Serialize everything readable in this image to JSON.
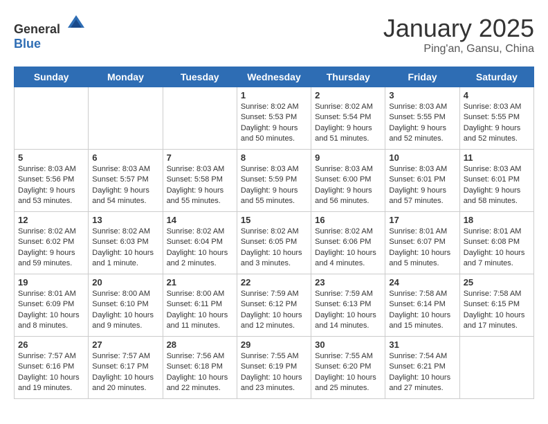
{
  "header": {
    "logo_general": "General",
    "logo_blue": "Blue",
    "title": "January 2025",
    "subtitle": "Ping'an, Gansu, China"
  },
  "days": [
    "Sunday",
    "Monday",
    "Tuesday",
    "Wednesday",
    "Thursday",
    "Friday",
    "Saturday"
  ],
  "weeks": [
    [
      {
        "date": "",
        "text": ""
      },
      {
        "date": "",
        "text": ""
      },
      {
        "date": "",
        "text": ""
      },
      {
        "date": "1",
        "text": "Sunrise: 8:02 AM\nSunset: 5:53 PM\nDaylight: 9 hours and 50 minutes."
      },
      {
        "date": "2",
        "text": "Sunrise: 8:02 AM\nSunset: 5:54 PM\nDaylight: 9 hours and 51 minutes."
      },
      {
        "date": "3",
        "text": "Sunrise: 8:03 AM\nSunset: 5:55 PM\nDaylight: 9 hours and 52 minutes."
      },
      {
        "date": "4",
        "text": "Sunrise: 8:03 AM\nSunset: 5:55 PM\nDaylight: 9 hours and 52 minutes."
      }
    ],
    [
      {
        "date": "5",
        "text": "Sunrise: 8:03 AM\nSunset: 5:56 PM\nDaylight: 9 hours and 53 minutes."
      },
      {
        "date": "6",
        "text": "Sunrise: 8:03 AM\nSunset: 5:57 PM\nDaylight: 9 hours and 54 minutes."
      },
      {
        "date": "7",
        "text": "Sunrise: 8:03 AM\nSunset: 5:58 PM\nDaylight: 9 hours and 55 minutes."
      },
      {
        "date": "8",
        "text": "Sunrise: 8:03 AM\nSunset: 5:59 PM\nDaylight: 9 hours and 55 minutes."
      },
      {
        "date": "9",
        "text": "Sunrise: 8:03 AM\nSunset: 6:00 PM\nDaylight: 9 hours and 56 minutes."
      },
      {
        "date": "10",
        "text": "Sunrise: 8:03 AM\nSunset: 6:01 PM\nDaylight: 9 hours and 57 minutes."
      },
      {
        "date": "11",
        "text": "Sunrise: 8:03 AM\nSunset: 6:01 PM\nDaylight: 9 hours and 58 minutes."
      }
    ],
    [
      {
        "date": "12",
        "text": "Sunrise: 8:02 AM\nSunset: 6:02 PM\nDaylight: 9 hours and 59 minutes."
      },
      {
        "date": "13",
        "text": "Sunrise: 8:02 AM\nSunset: 6:03 PM\nDaylight: 10 hours and 1 minute."
      },
      {
        "date": "14",
        "text": "Sunrise: 8:02 AM\nSunset: 6:04 PM\nDaylight: 10 hours and 2 minutes."
      },
      {
        "date": "15",
        "text": "Sunrise: 8:02 AM\nSunset: 6:05 PM\nDaylight: 10 hours and 3 minutes."
      },
      {
        "date": "16",
        "text": "Sunrise: 8:02 AM\nSunset: 6:06 PM\nDaylight: 10 hours and 4 minutes."
      },
      {
        "date": "17",
        "text": "Sunrise: 8:01 AM\nSunset: 6:07 PM\nDaylight: 10 hours and 5 minutes."
      },
      {
        "date": "18",
        "text": "Sunrise: 8:01 AM\nSunset: 6:08 PM\nDaylight: 10 hours and 7 minutes."
      }
    ],
    [
      {
        "date": "19",
        "text": "Sunrise: 8:01 AM\nSunset: 6:09 PM\nDaylight: 10 hours and 8 minutes."
      },
      {
        "date": "20",
        "text": "Sunrise: 8:00 AM\nSunset: 6:10 PM\nDaylight: 10 hours and 9 minutes."
      },
      {
        "date": "21",
        "text": "Sunrise: 8:00 AM\nSunset: 6:11 PM\nDaylight: 10 hours and 11 minutes."
      },
      {
        "date": "22",
        "text": "Sunrise: 7:59 AM\nSunset: 6:12 PM\nDaylight: 10 hours and 12 minutes."
      },
      {
        "date": "23",
        "text": "Sunrise: 7:59 AM\nSunset: 6:13 PM\nDaylight: 10 hours and 14 minutes."
      },
      {
        "date": "24",
        "text": "Sunrise: 7:58 AM\nSunset: 6:14 PM\nDaylight: 10 hours and 15 minutes."
      },
      {
        "date": "25",
        "text": "Sunrise: 7:58 AM\nSunset: 6:15 PM\nDaylight: 10 hours and 17 minutes."
      }
    ],
    [
      {
        "date": "26",
        "text": "Sunrise: 7:57 AM\nSunset: 6:16 PM\nDaylight: 10 hours and 19 minutes."
      },
      {
        "date": "27",
        "text": "Sunrise: 7:57 AM\nSunset: 6:17 PM\nDaylight: 10 hours and 20 minutes."
      },
      {
        "date": "28",
        "text": "Sunrise: 7:56 AM\nSunset: 6:18 PM\nDaylight: 10 hours and 22 minutes."
      },
      {
        "date": "29",
        "text": "Sunrise: 7:55 AM\nSunset: 6:19 PM\nDaylight: 10 hours and 23 minutes."
      },
      {
        "date": "30",
        "text": "Sunrise: 7:55 AM\nSunset: 6:20 PM\nDaylight: 10 hours and 25 minutes."
      },
      {
        "date": "31",
        "text": "Sunrise: 7:54 AM\nSunset: 6:21 PM\nDaylight: 10 hours and 27 minutes."
      },
      {
        "date": "",
        "text": ""
      }
    ]
  ]
}
